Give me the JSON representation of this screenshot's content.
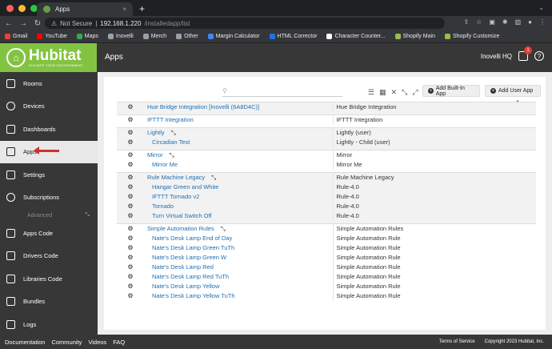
{
  "browser": {
    "tab_title": "Apps",
    "new_tab": "+",
    "security": "Not Secure",
    "url_host": "192.168.1.220",
    "url_path": "/installedapp/list",
    "bookmarks": [
      "Gmail",
      "YouTube",
      "Maps",
      "Inovelli",
      "Merch",
      "Other",
      "Margin Calculator",
      "HTML Corrector",
      "Character Counter...",
      "Shopify Main",
      "Shopify Customize"
    ]
  },
  "header": {
    "brand": "Hubitat",
    "brand_tagline": "ELEVATE YOUR ENVIRONMENT",
    "page_title": "Apps",
    "hub_name": "Inovelli HQ",
    "notification_count": "1"
  },
  "sidebar": {
    "items": [
      {
        "label": "Rooms"
      },
      {
        "label": "Devices"
      },
      {
        "label": "Dashboards"
      },
      {
        "label": "Apps"
      },
      {
        "label": "Settings"
      },
      {
        "label": "Subscriptions"
      }
    ],
    "advanced_label": "Advanced",
    "advanced_items": [
      {
        "label": "Apps Code"
      },
      {
        "label": "Drivers Code"
      },
      {
        "label": "Libraries Code"
      },
      {
        "label": "Bundles"
      },
      {
        "label": "Logs"
      }
    ]
  },
  "toolbar": {
    "add_builtin": "Add Built-In App",
    "add_user": "Add User App"
  },
  "apps": [
    [
      {
        "name": "Hue Bridge Integration [Inovelli (6A8D4C)]",
        "type": "Hue Bridge Integration"
      }
    ],
    [
      {
        "name": "IFTTT Integration",
        "type": "IFTTT Integration"
      }
    ],
    [
      {
        "name": "Lightly",
        "type": "Lightly (user)"
      },
      {
        "name": "Circadian Test",
        "type": "Lightly - Child (user)"
      }
    ],
    [
      {
        "name": "Mirror",
        "type": "Mirror"
      },
      {
        "name": "Mirror Me",
        "type": "Mirror Me"
      }
    ],
    [
      {
        "name": "Rule Machine Legacy",
        "type": "Rule Machine Legacy"
      },
      {
        "name": "Hangar Green and White",
        "type": "Rule-4.0"
      },
      {
        "name": "IFTTT Tornado v2",
        "type": "Rule-4.0"
      },
      {
        "name": "Tornado",
        "type": "Rule-4.0"
      },
      {
        "name": "Turn Virtual Switch Off",
        "type": "Rule-4.0"
      }
    ],
    [
      {
        "name": "Simple Automation Rules",
        "type": "Simple Automation Rules"
      },
      {
        "name": "Nate's Desk Lamp End of Day",
        "type": "Simple Automation Rule"
      },
      {
        "name": "Nate's Desk Lamp Green TuTh",
        "type": "Simple Automation Rule"
      },
      {
        "name": "Nate's Desk Lamp Green W",
        "type": "Simple Automation Rule"
      },
      {
        "name": "Nate's Desk Lamp Red",
        "type": "Simple Automation Rule"
      },
      {
        "name": "Nate's Desk Lamp Red TuTh",
        "type": "Simple Automation Rule"
      },
      {
        "name": "Nate's Desk Lamp Yellow",
        "type": "Simple Automation Rule"
      },
      {
        "name": "Nate's Desk Lamp Yellow TuTh",
        "type": "Simple Automation Rule"
      }
    ]
  ],
  "footer": {
    "links": [
      "Documentation",
      "Community",
      "Videos",
      "FAQ"
    ],
    "terms": "Terms of Service",
    "copyright": "Copyright 2023 Hubitat, Inc."
  },
  "colors": {
    "brand_green": "#83c342",
    "header_bg": "#373737",
    "link": "#1f6fb2",
    "annotation_red": "#d32f2f"
  }
}
